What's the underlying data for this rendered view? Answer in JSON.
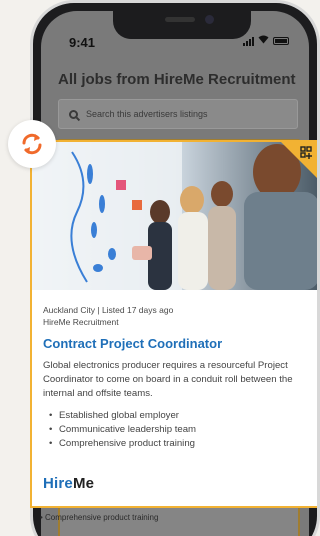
{
  "status_bar": {
    "time": "9:41"
  },
  "screen": {
    "title": "All jobs from HireMe Recruitment",
    "search_placeholder": "Search this advertisers listings",
    "behind_bullet": "• Comprehensive product training"
  },
  "job_card": {
    "location": "Auckland City",
    "listed": "Listed 17 days ago",
    "separator": "|",
    "advertiser": "HireMe Recruitment",
    "title": "Contract Project Coordinator",
    "description": "Global electronics producer requires a resourceful Project Coordinator to come on board in a conduit roll between the internal and offsite teams.",
    "bullets": [
      "Established global employer",
      "Communicative leadership team",
      "Comprehensive product training"
    ],
    "logo": {
      "hire": "Hire",
      "me": "Me"
    }
  },
  "icons": {
    "badge": "refresh-icon",
    "corner": "featured-tag-icon"
  },
  "colors": {
    "accent_blue": "#1f6fb8",
    "card_border": "#f2b233",
    "badge_orange": "#f06a2b"
  }
}
